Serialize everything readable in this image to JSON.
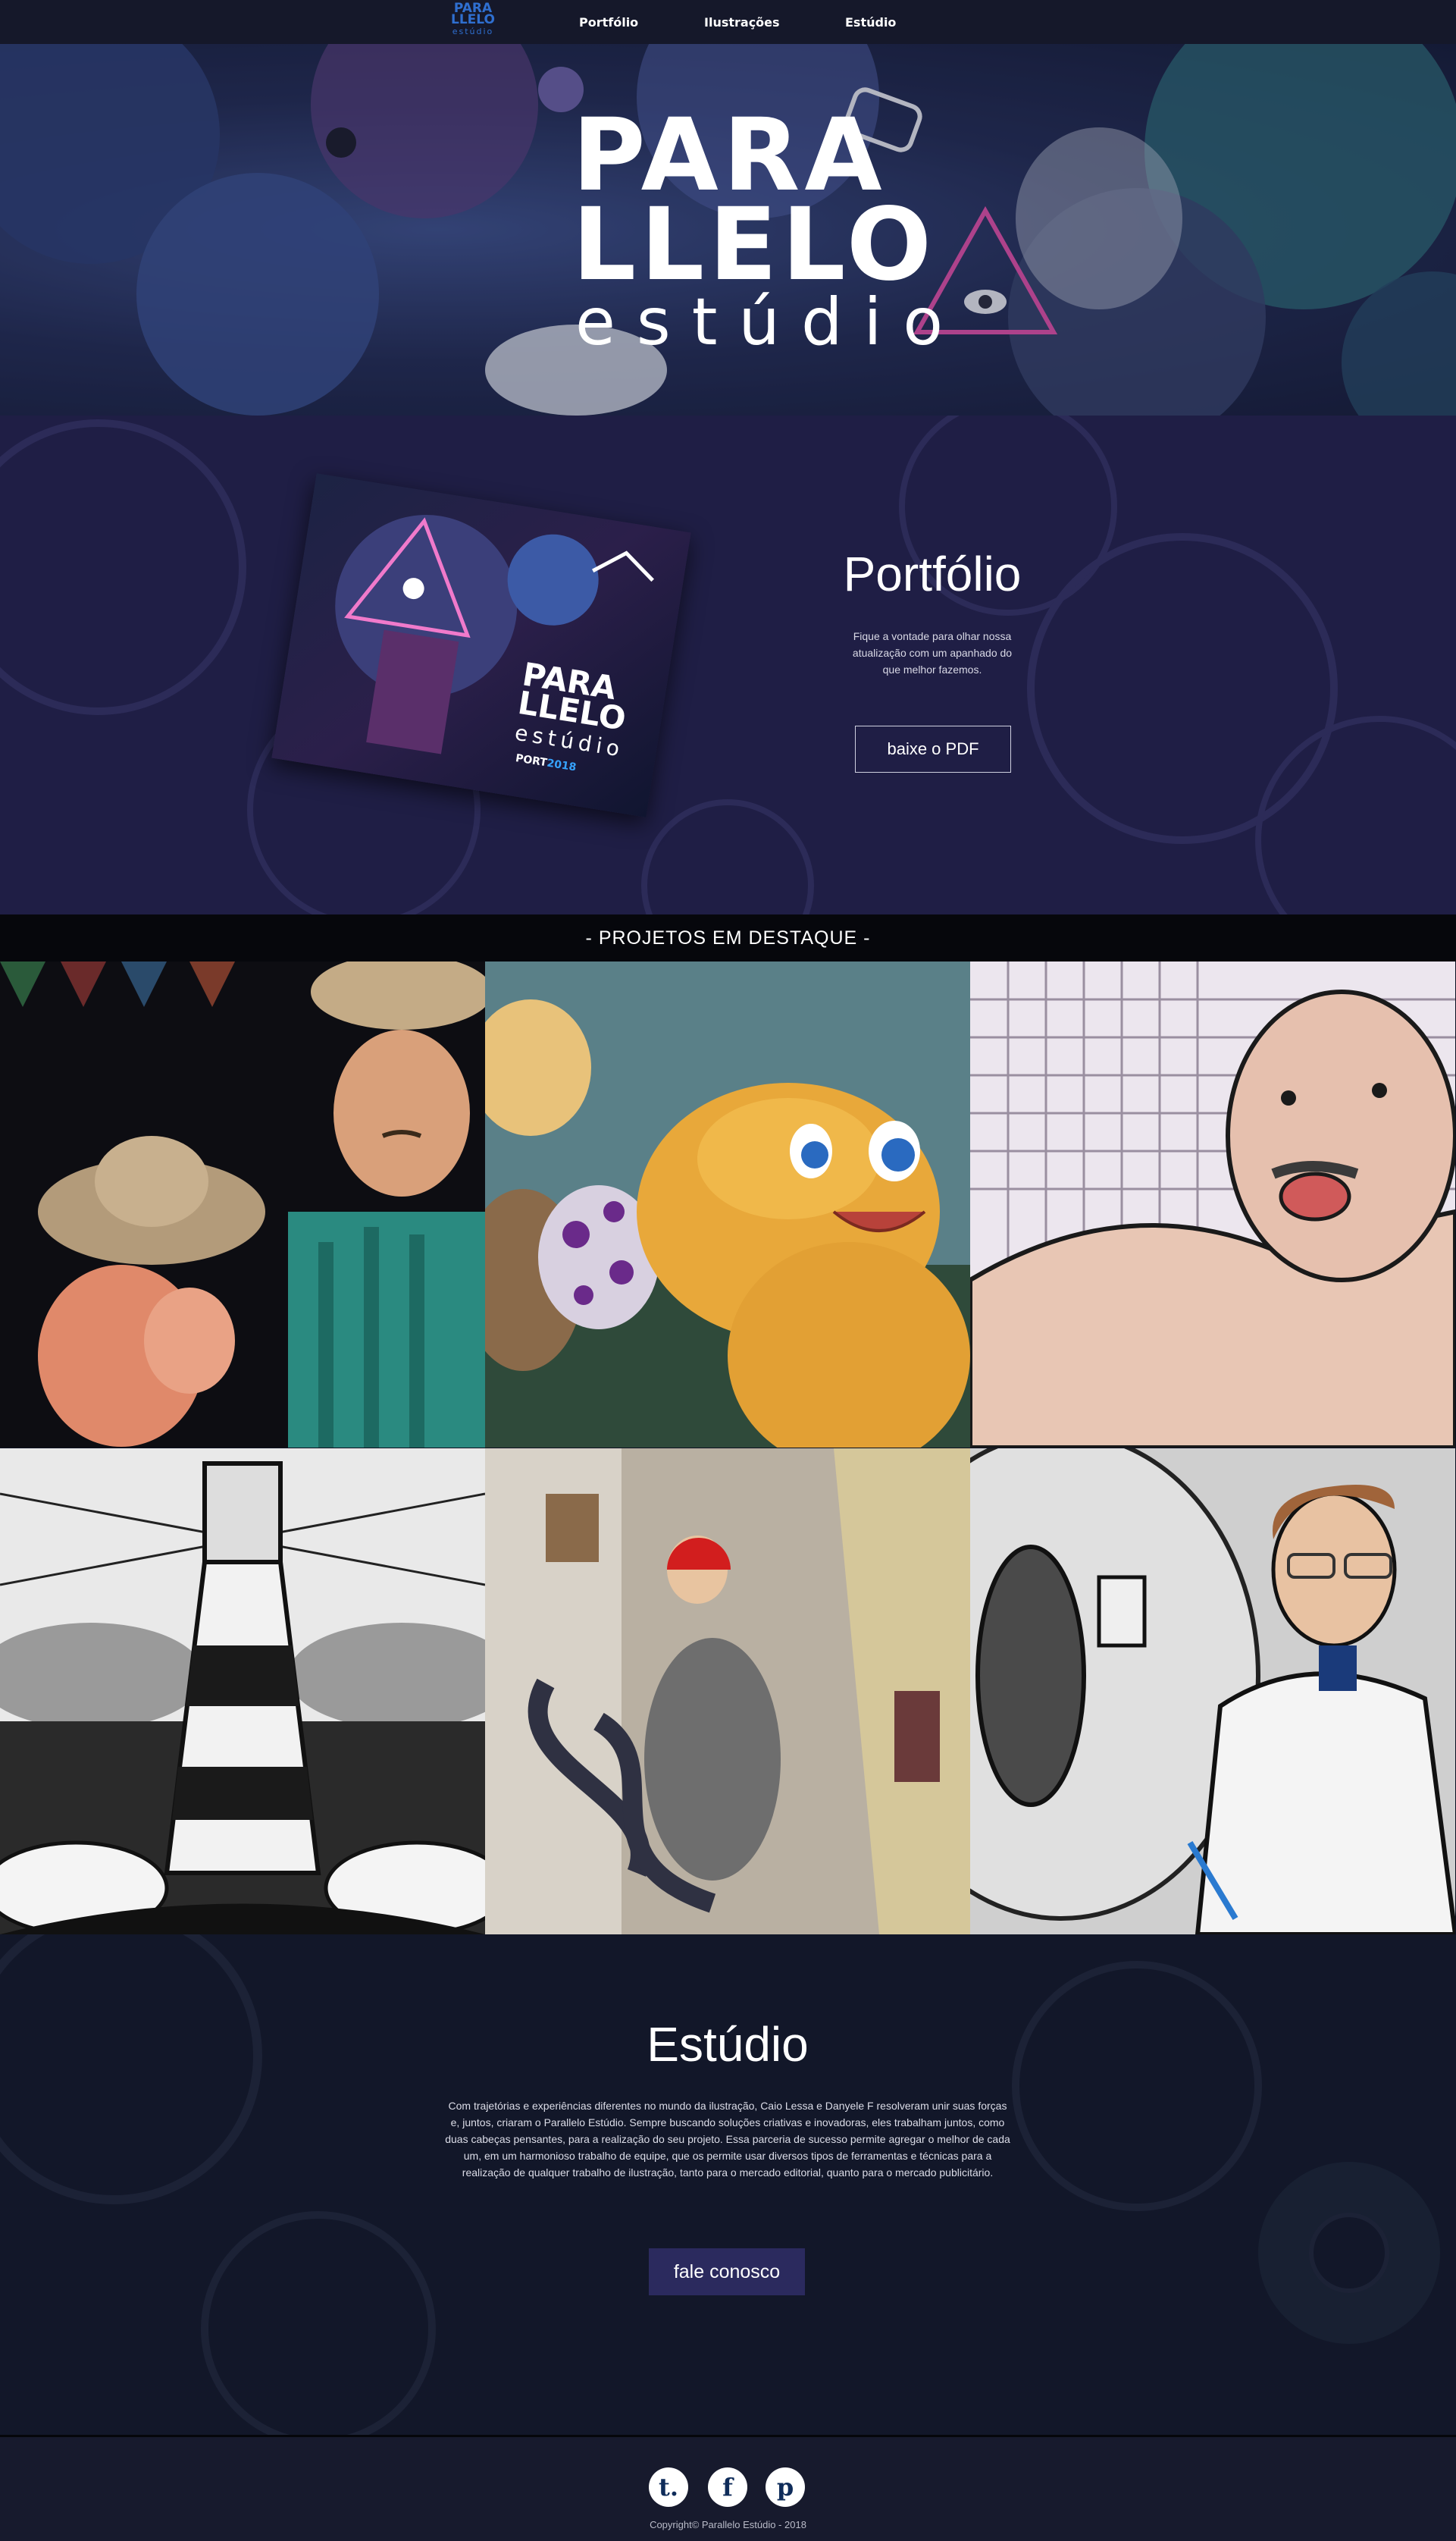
{
  "nav": {
    "logo": {
      "line1": "PARA",
      "line2": "LLELO",
      "line3": "estúdio"
    },
    "links": [
      "Portfólio",
      "Ilustrações",
      "Estúdio"
    ]
  },
  "hero": {
    "logo": {
      "line1": "PARA",
      "line2": "LLELO",
      "line3": "estúdio"
    }
  },
  "portfolio": {
    "title": "Portfólio",
    "text": "Fique a vontade para olhar nossa atualização com um apanhado do que melhor fazemos.",
    "button": "baixe o PDF",
    "cover": {
      "line1": "PARA",
      "line2": "LLELO",
      "line3": "estúdio",
      "tag_prefix": "PORT",
      "tag_year": "2018"
    }
  },
  "projects": {
    "header": "- PROJETOS EM DESTAQUE -",
    "tiles": [
      {
        "name": "festa-junina-illustration"
      },
      {
        "name": "dinosaur-illustration"
      },
      {
        "name": "old-man-illustration"
      },
      {
        "name": "lighthouse-illustration"
      },
      {
        "name": "worker-hose-illustration"
      },
      {
        "name": "scientist-illustration"
      }
    ]
  },
  "estudio": {
    "title": "Estúdio",
    "text": "Com trajetórias e experiências diferentes no mundo da ilustração, Caio Lessa e Danyele F resolveram unir suas forças e, juntos, criaram o Parallelo Estúdio. Sempre buscando soluções criativas e inovadoras, eles trabalham juntos, como duas cabeças pensantes, para a realização do seu projeto. Essa parceria de sucesso permite agregar o melhor de cada um, em um harmonioso trabalho de equipe, que os permite usar diversos tipos de ferramentas e técnicas para a realização de qualquer trabalho de ilustração, tanto para o mercado editorial, quanto para o mercado publicitário.",
    "button": "fale conosco"
  },
  "footer": {
    "social": [
      {
        "glyph": "t.",
        "icon": "tumblr-icon"
      },
      {
        "glyph": "f",
        "icon": "facebook-icon"
      },
      {
        "glyph": "p",
        "icon": "pinterest-icon"
      }
    ],
    "copyright": "Copyright© Parallelo Estúdio - 2018"
  },
  "colors": {
    "nav_bg": "#15182a",
    "portfolio_bg": "#1f1e45",
    "estudio_bg": "#121729",
    "button_bg": "#2b2a5e",
    "logo_blue": "#2f6fd0"
  }
}
